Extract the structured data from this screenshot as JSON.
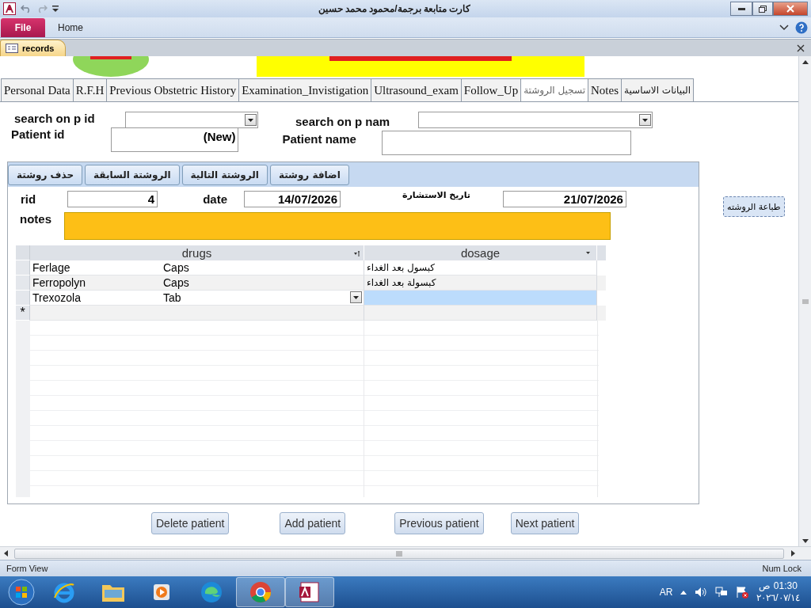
{
  "window": {
    "title": "كارت متابعة برجمة/محمود محمد حسين"
  },
  "ribbon_tabs": [
    {
      "label": "File",
      "kind": "file"
    },
    {
      "label": "Home",
      "kind": "tab"
    }
  ],
  "document_tab": {
    "title": "records"
  },
  "form_tabs": [
    {
      "label": "Personal Data",
      "selected": false,
      "kind": "latin"
    },
    {
      "label": "R.F.H",
      "selected": false,
      "kind": "latin"
    },
    {
      "label": "Previous Obstetric History",
      "selected": false,
      "kind": "latin"
    },
    {
      "label": "Examination_Invistigation",
      "selected": false,
      "kind": "latin"
    },
    {
      "label": "Ultrasound_exam",
      "selected": false,
      "kind": "latin"
    },
    {
      "label": "Follow_Up",
      "selected": false,
      "kind": "latin"
    },
    {
      "label": "تسجيل الروشتة",
      "selected": true,
      "kind": "arabic"
    },
    {
      "label": "Notes",
      "selected": false,
      "kind": "latin"
    },
    {
      "label": "البيانات الاساسية",
      "selected": false,
      "kind": "arabic"
    }
  ],
  "search_id": {
    "label": "search on p id"
  },
  "search_name": {
    "label": "search on p nam"
  },
  "patient_id": {
    "label": "Patient id",
    "value": "(New)"
  },
  "patient_name": {
    "label": "Patient name"
  },
  "prescription": {
    "buttons": [
      "اضافة روشتة",
      "الروشتة التالية",
      "الروشتة السابقة",
      "حذف روشتة"
    ],
    "rid": {
      "label": "rid",
      "value": "4"
    },
    "date": {
      "label": "date",
      "value": "14/07/2026"
    },
    "consult_date": {
      "label": "تاريخ الاستشارة",
      "value": "21/07/2026"
    },
    "notes": {
      "label": "notes"
    },
    "drugs_table": {
      "columns": [
        "drugs",
        "dosage"
      ],
      "rows": [
        {
          "drug": "Ferlage",
          "form": "Caps",
          "dosage": "كبسول بعد الغداء",
          "selected": false
        },
        {
          "drug": "Ferropolyn",
          "form": "Caps",
          "dosage": "كبسولة بعد الغداء",
          "selected": false
        },
        {
          "drug": "Trexozola",
          "form": "Tab",
          "dosage": "",
          "selected": true
        }
      ],
      "new_row_marker": "*"
    }
  },
  "print_button": "طباعة الروشته",
  "patient_buttons": [
    "Delete patient",
    "Add patient",
    "Previous patient",
    "Next patient"
  ],
  "status_bar": {
    "left": "Form View",
    "right": "Num Lock"
  },
  "taskbar": {
    "language": "AR",
    "time": "ص 01:30",
    "date": "٢٠٢٦/٠٧/١٤"
  }
}
